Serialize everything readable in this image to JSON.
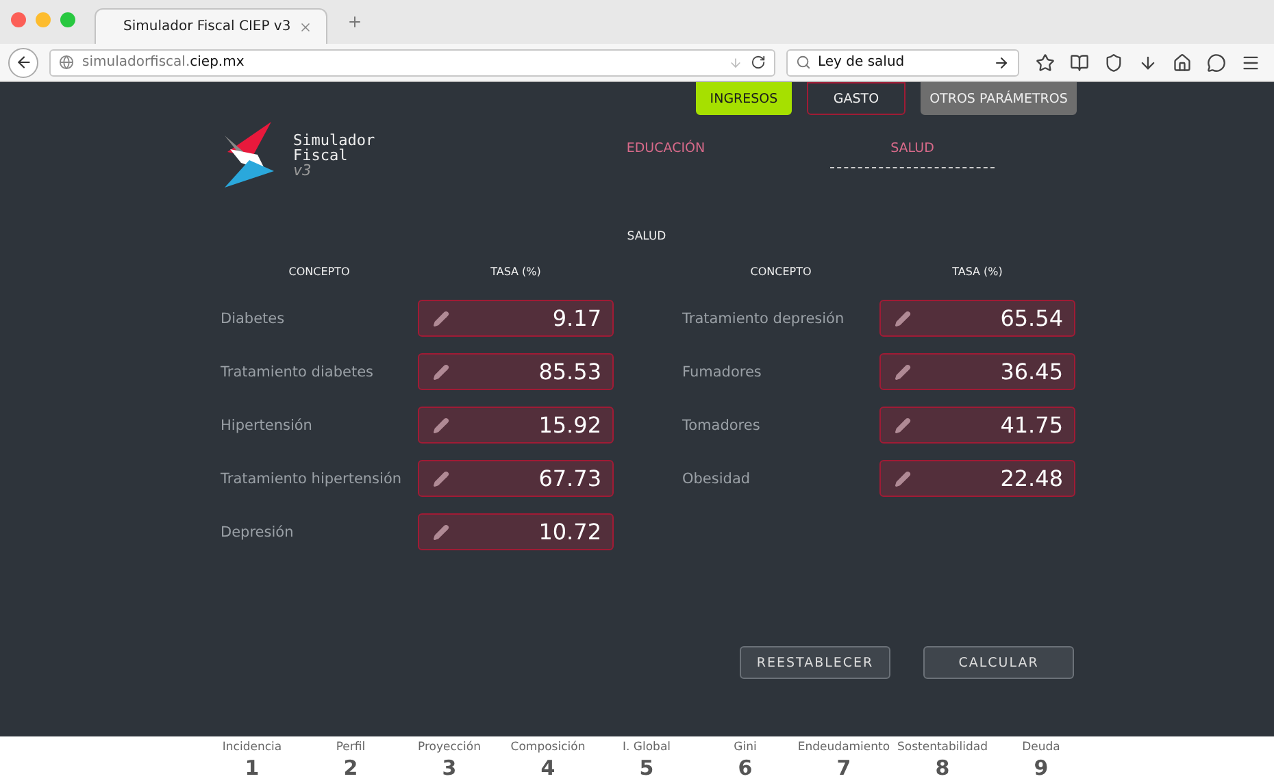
{
  "browser": {
    "tab_title": "Simulador Fiscal CIEP v3",
    "url_host": "simuladorfiscal.",
    "url_domain": "ciep.mx",
    "search_value": "Ley de salud"
  },
  "top_tabs": [
    {
      "label": "INGRESOS",
      "kind": "primary"
    },
    {
      "label": "GASTO",
      "kind": "outlined"
    },
    {
      "label": "OTROS PARÁMETROS",
      "kind": "muted"
    }
  ],
  "logo": {
    "lines": [
      "Simulador",
      "Fiscal"
    ],
    "version": "v3"
  },
  "sub_tabs": [
    {
      "label": "EDUCACIÓN",
      "selected": false
    },
    {
      "label": "SALUD",
      "selected": true
    }
  ],
  "section_title": "SALUD",
  "columns": [
    {
      "headers": [
        "CONCEPTO",
        "TASA (%)"
      ],
      "rows": [
        {
          "label": "Diabetes",
          "value": "9.17"
        },
        {
          "label": "Tratamiento diabetes",
          "value": "85.53"
        },
        {
          "label": "Hipertensión",
          "value": "15.92"
        },
        {
          "label": "Tratamiento hipertensión",
          "value": "67.73"
        },
        {
          "label": "Depresión",
          "value": "10.72"
        }
      ]
    },
    {
      "headers": [
        "CONCEPTO",
        "TASA (%)"
      ],
      "rows": [
        {
          "label": "Tratamiento depresión",
          "value": "65.54"
        },
        {
          "label": "Fumadores",
          "value": "36.45"
        },
        {
          "label": "Tomadores",
          "value": "41.75"
        },
        {
          "label": "Obesidad",
          "value": "22.48"
        }
      ]
    }
  ],
  "buttons": [
    "REESTABLECER",
    "CALCULAR"
  ],
  "footer_nav": [
    {
      "label": "Incidencia",
      "number": "1"
    },
    {
      "label": "Perfil",
      "number": "2"
    },
    {
      "label": "Proyección",
      "number": "3"
    },
    {
      "label": "Composición",
      "number": "4"
    },
    {
      "label": "I. Global",
      "number": "5"
    },
    {
      "label": "Gini",
      "number": "6"
    },
    {
      "label": "Endeudamiento",
      "number": "7"
    },
    {
      "label": "Sostentabilidad",
      "number": "8"
    },
    {
      "label": "Deuda",
      "number": "9"
    }
  ]
}
